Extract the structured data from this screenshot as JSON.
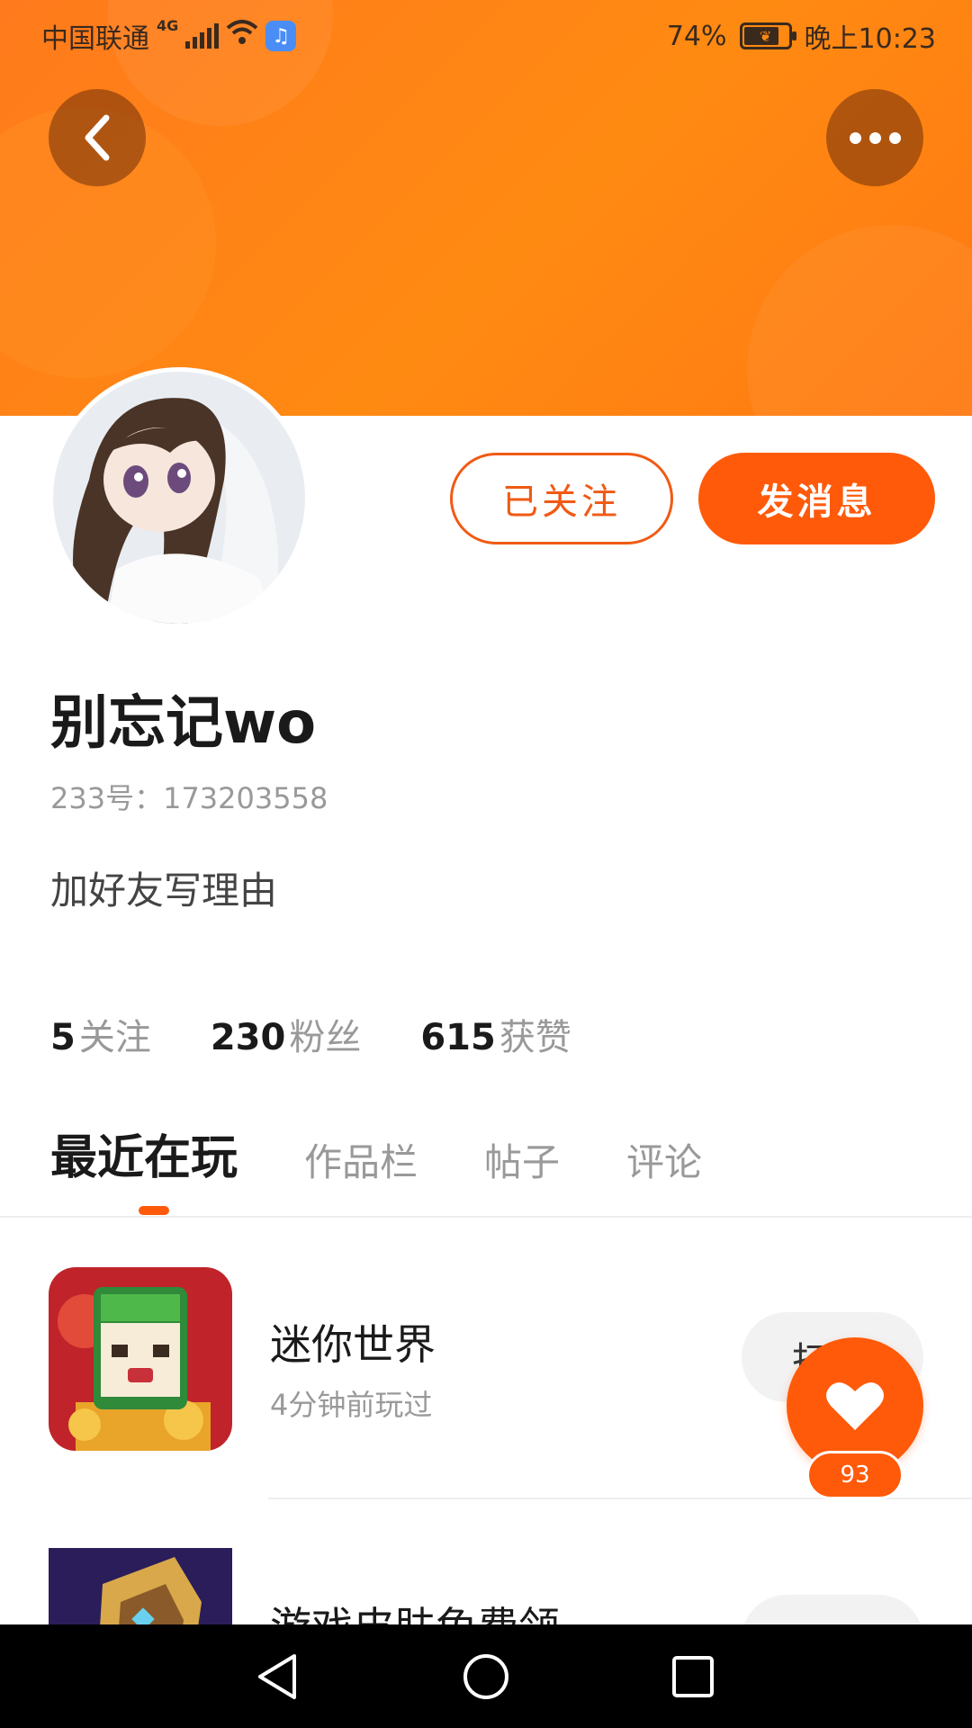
{
  "status_bar": {
    "carrier": "中国联通",
    "network": "4G",
    "battery": "74%",
    "battery_level": 0.74,
    "time": "晚上10:23"
  },
  "profile": {
    "username": "别忘记wo",
    "user_id": "233号：173203558",
    "bio": "加好友写理由",
    "follow_button": "已关注",
    "message_button": "发消息"
  },
  "stats": [
    {
      "value": "5",
      "label": "关注"
    },
    {
      "value": "230",
      "label": "粉丝"
    },
    {
      "value": "615",
      "label": "获赞"
    }
  ],
  "tabs": [
    {
      "label": "最近在玩",
      "active": true
    },
    {
      "label": "作品栏",
      "active": false
    },
    {
      "label": "帖子",
      "active": false
    },
    {
      "label": "评论",
      "active": false
    }
  ],
  "games": [
    {
      "title": "迷你世界",
      "subtitle": "4分钟前玩过",
      "button": "打"
    },
    {
      "title": "游戏皮肤免费领",
      "subtitle": "",
      "button": ""
    }
  ],
  "fab": {
    "count": "93"
  },
  "colors": {
    "accent": "#ff5a0a",
    "header_orange": "#ff7a1c"
  },
  "icons": {
    "back": "chevron-left-icon",
    "more": "more-dots-icon",
    "fab": "heart-icon",
    "nav_back": "triangle-back-icon",
    "nav_home": "circle-home-icon",
    "nav_recent": "square-recent-icon"
  }
}
